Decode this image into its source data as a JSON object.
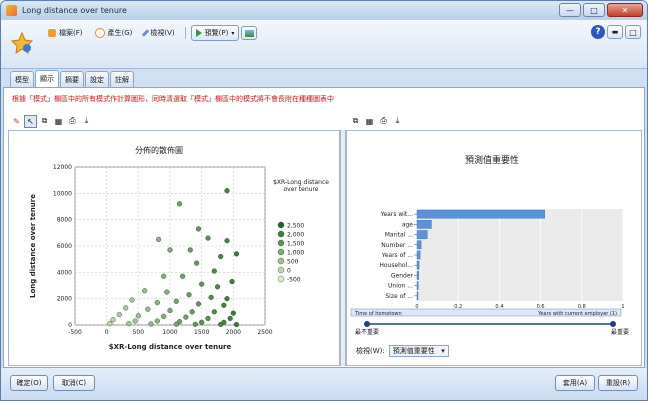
{
  "window": {
    "title": "Long distance over tenure",
    "minimize_label": "—",
    "maximize_label": "□",
    "close_label": "✕"
  },
  "menu": {
    "file": "檔案(F)",
    "generate": "產生(G)",
    "edit": "檢視(V)",
    "preview": "預覽(P)",
    "help_label": "?"
  },
  "tabs": [
    "模型",
    "顯示",
    "摘要",
    "設定",
    "註解"
  ],
  "warning": "根據「模式」欄區中的所有模式作計算圖形，同時清選取「模式」欄區中的模式將不會長附在種種圖表中",
  "scatter": {
    "title": "分佈的散佈圖",
    "legend_title": "$XR-Long distance over tenure",
    "legend_values": [
      "2,500",
      "2,000",
      "1,500",
      "1,000",
      "500",
      "0",
      "-500"
    ]
  },
  "importance": {
    "title": "預測值重要性",
    "scale_left": "最不重要",
    "scale_right": "最重要",
    "axis_start_label": "Time of hometown",
    "axis_end_label": "Years with current employer (1)"
  },
  "view": {
    "label": "檢視(W):",
    "selected": "預測值重要性"
  },
  "footer": {
    "ok": "確定(O)",
    "cancel": "取消(C)",
    "apply": "套用(A)",
    "reset": "重設(R)"
  },
  "chart_data": [
    {
      "type": "scatter",
      "title": "分佈的散佈圖",
      "xlabel": "$XR-Long distance over tenure",
      "ylabel": "Long distance over tenure",
      "xlim": [
        -500,
        2500
      ],
      "ylim": [
        0,
        12000
      ],
      "x_ticks": [
        "-500",
        "0",
        "500",
        "1000",
        "1500",
        "2000",
        "2500"
      ],
      "y_ticks": [
        "0",
        "2000",
        "4000",
        "6000",
        "8000",
        "10000",
        "12000"
      ],
      "grid": true,
      "legend": "right",
      "series": [
        {
          "points": [
            [
              1900,
              10200
            ],
            [
              1150,
              9200
            ],
            [
              820,
              6500
            ],
            [
              1450,
              7300
            ],
            [
              1600,
              6600
            ],
            [
              1900,
              6400
            ],
            [
              1320,
              5700
            ],
            [
              2050,
              5400
            ],
            [
              1000,
              5700
            ],
            [
              1800,
              5200
            ],
            [
              1420,
              4700
            ],
            [
              1700,
              4100
            ],
            [
              900,
              3700
            ],
            [
              1200,
              3700
            ],
            [
              1980,
              3300
            ],
            [
              1500,
              3100
            ],
            [
              1750,
              2900
            ],
            [
              600,
              2600
            ],
            [
              950,
              2500
            ],
            [
              1300,
              2300
            ],
            [
              1650,
              2100
            ],
            [
              1900,
              2000
            ],
            [
              400,
              1900
            ],
            [
              800,
              1700
            ],
            [
              1100,
              1800
            ],
            [
              1450,
              1600
            ],
            [
              1850,
              1500
            ],
            [
              300,
              1300
            ],
            [
              650,
              1200
            ],
            [
              1000,
              1100
            ],
            [
              1350,
              1000
            ],
            [
              1700,
              1000
            ],
            [
              2000,
              900
            ],
            [
              200,
              800
            ],
            [
              500,
              700
            ],
            [
              900,
              650
            ],
            [
              1250,
              600
            ],
            [
              1600,
              500
            ],
            [
              1950,
              500
            ],
            [
              100,
              400
            ],
            [
              450,
              300
            ],
            [
              800,
              300
            ],
            [
              1150,
              250
            ],
            [
              1500,
              200
            ],
            [
              1850,
              200
            ],
            [
              50,
              100
            ],
            [
              350,
              100
            ],
            [
              700,
              80
            ],
            [
              1100,
              60
            ],
            [
              1400,
              50
            ],
            [
              1800,
              40
            ],
            [
              2050,
              30
            ]
          ]
        }
      ]
    },
    {
      "type": "bar",
      "title": "預測值重要性",
      "orientation": "horizontal",
      "categories": [
        "Years wit...",
        "age",
        "Marital ...",
        "Number ...",
        "Years of ...",
        "Househol...",
        "Gender",
        "Union ...",
        "Size of ..."
      ],
      "values": [
        0.62,
        0.07,
        0.05,
        0.02,
        0.015,
        0.01,
        0.008,
        0.006,
        0.004
      ],
      "xlim": [
        0,
        1
      ],
      "x_ticks": [
        "0",
        "0.2",
        "0.4",
        "0.6",
        "0.8",
        "1"
      ],
      "grid": true,
      "bar_color": "#5b93d6"
    }
  ]
}
